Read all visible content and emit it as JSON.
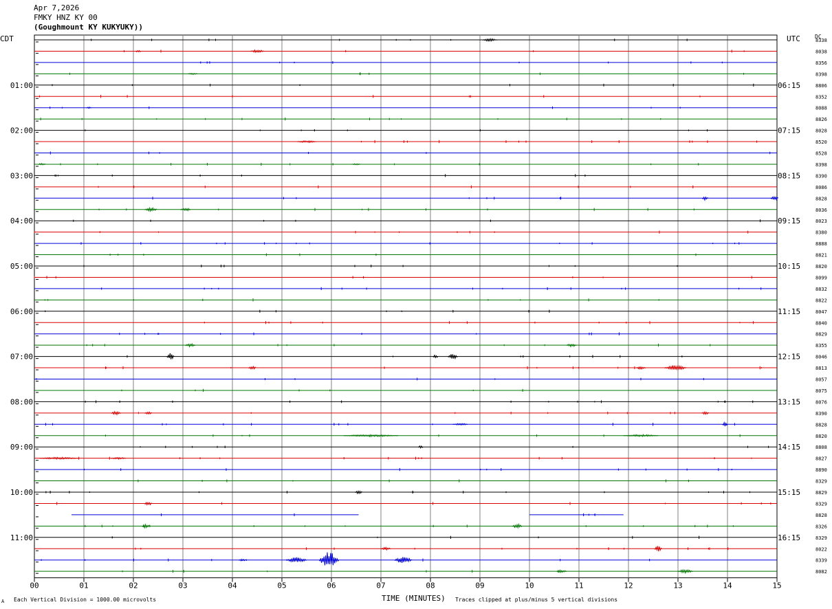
{
  "header": {
    "date": "Apr 7,2026",
    "station": "FMKY HNZ KY 00",
    "location": "(Goughmount KY KUKYUKY))"
  },
  "left_label": "CDT",
  "right_label": "UTC",
  "dc_label": "DC",
  "footer": {
    "scale": "Each Vertical Division = 1000.00 microvolts",
    "xlabel": "TIME (MINUTES)",
    "clip": "Traces clipped at plus/minus 5 vertical divisions",
    "corner_mark": "A"
  },
  "colors": {
    "black": "#000000",
    "red": "#dd0000",
    "blue": "#0000dd",
    "green": "#007700",
    "grid": "#808080"
  },
  "chart_data": {
    "type": "line",
    "title": "",
    "xlabel": "TIME (MINUTES)",
    "ylabel": "",
    "xlim": [
      0,
      15
    ],
    "x_ticks": [
      "00",
      "01",
      "02",
      "03",
      "04",
      "05",
      "06",
      "07",
      "08",
      "09",
      "10",
      "11",
      "12",
      "13",
      "14",
      "15"
    ],
    "trace_count": 48,
    "trace_color_cycle": [
      "black",
      "red",
      "blue",
      "green"
    ],
    "left_time_labels": [
      "01:00",
      "02:00",
      "03:00",
      "04:00",
      "05:00",
      "06:00",
      "07:00",
      "08:00",
      "09:00",
      "10:00",
      "11:00"
    ],
    "right_time_labels": [
      "06:15",
      "07:15",
      "08:15",
      "09:15",
      "10:15",
      "11:15",
      "12:15",
      "13:15",
      "14:15",
      "15:15",
      "16:15"
    ],
    "hour_label_trace_indices": [
      4,
      8,
      12,
      16,
      20,
      24,
      28,
      32,
      36,
      40,
      44
    ],
    "dc_values": [
      "8338",
      "8038",
      "8356",
      "8398",
      "8806",
      "8352",
      "8088",
      "8826",
      "8028",
      "8520",
      "8528",
      "8398",
      "8390",
      "8086",
      "8828",
      "8036",
      "8023",
      "8380",
      "8888",
      "8821",
      "8820",
      "8099",
      "8832",
      "8822",
      "8047",
      "8840",
      "8829",
      "8355",
      "8046",
      "8813",
      "8057",
      "8075",
      "8076",
      "8390",
      "8828",
      "8820",
      "8808",
      "8827",
      "8890",
      "8329",
      "8829",
      "8329",
      "8828",
      "8326",
      "8329",
      "8022",
      "8339",
      "8082"
    ],
    "events": [
      {
        "trace": 0,
        "minute": 9.2,
        "width": 0.3,
        "amp": 2
      },
      {
        "trace": 1,
        "minute": 2.1,
        "width": 0.1,
        "amp": 2
      },
      {
        "trace": 1,
        "minute": 4.5,
        "width": 0.3,
        "amp": 2
      },
      {
        "trace": 3,
        "minute": 3.2,
        "width": 0.2,
        "amp": 1
      },
      {
        "trace": 6,
        "minute": 1.1,
        "width": 0.1,
        "amp": 1
      },
      {
        "trace": 9,
        "minute": 5.5,
        "width": 0.4,
        "amp": 1.5
      },
      {
        "trace": 11,
        "minute": 0.15,
        "width": 0.15,
        "amp": 1.5
      },
      {
        "trace": 11,
        "minute": 6.5,
        "width": 0.2,
        "amp": 1
      },
      {
        "trace": 14,
        "minute": 13.55,
        "width": 0.12,
        "amp": 3
      },
      {
        "trace": 14,
        "minute": 14.95,
        "width": 0.15,
        "amp": 4
      },
      {
        "trace": 15,
        "minute": 2.35,
        "width": 0.25,
        "amp": 3
      },
      {
        "trace": 15,
        "minute": 3.05,
        "width": 0.2,
        "amp": 2.5
      },
      {
        "trace": 27,
        "minute": 3.15,
        "width": 0.2,
        "amp": 2.5
      },
      {
        "trace": 27,
        "minute": 10.85,
        "width": 0.2,
        "amp": 2.5
      },
      {
        "trace": 28,
        "minute": 2.75,
        "width": 0.15,
        "amp": 5
      },
      {
        "trace": 28,
        "minute": 8.1,
        "width": 0.1,
        "amp": 3
      },
      {
        "trace": 28,
        "minute": 8.45,
        "width": 0.2,
        "amp": 4
      },
      {
        "trace": 29,
        "minute": 4.4,
        "width": 0.15,
        "amp": 3
      },
      {
        "trace": 29,
        "minute": 12.25,
        "width": 0.2,
        "amp": 2
      },
      {
        "trace": 29,
        "minute": 12.95,
        "width": 0.45,
        "amp": 4
      },
      {
        "trace": 33,
        "minute": 1.65,
        "width": 0.2,
        "amp": 2.5
      },
      {
        "trace": 33,
        "minute": 2.3,
        "width": 0.15,
        "amp": 2
      },
      {
        "trace": 33,
        "minute": 13.55,
        "width": 0.15,
        "amp": 2
      },
      {
        "trace": 34,
        "minute": 8.6,
        "width": 0.3,
        "amp": 1.5
      },
      {
        "trace": 34,
        "minute": 13.95,
        "width": 0.1,
        "amp": 4
      },
      {
        "trace": 35,
        "minute": 6.8,
        "width": 1.1,
        "amp": 1.5
      },
      {
        "trace": 35,
        "minute": 12.25,
        "width": 0.7,
        "amp": 1.5
      },
      {
        "trace": 36,
        "minute": 7.8,
        "width": 0.1,
        "amp": 2
      },
      {
        "trace": 37,
        "minute": 0.5,
        "width": 0.8,
        "amp": 1.5
      },
      {
        "trace": 37,
        "minute": 1.7,
        "width": 0.3,
        "amp": 1.5
      },
      {
        "trace": 40,
        "minute": 6.55,
        "width": 0.15,
        "amp": 2.5
      },
      {
        "trace": 41,
        "minute": 2.3,
        "width": 0.15,
        "amp": 3
      },
      {
        "trace": 43,
        "minute": 2.25,
        "width": 0.15,
        "amp": 3
      },
      {
        "trace": 43,
        "minute": 9.75,
        "width": 0.2,
        "amp": 3
      },
      {
        "trace": 45,
        "minute": 7.1,
        "width": 0.2,
        "amp": 2
      },
      {
        "trace": 45,
        "minute": 12.6,
        "width": 0.15,
        "amp": 4
      },
      {
        "trace": 46,
        "minute": 4.2,
        "width": 0.15,
        "amp": 2
      },
      {
        "trace": 46,
        "minute": 5.3,
        "width": 0.4,
        "amp": 4
      },
      {
        "trace": 46,
        "minute": 5.95,
        "width": 0.4,
        "amp": 12
      },
      {
        "trace": 46,
        "minute": 7.45,
        "width": 0.35,
        "amp": 5
      },
      {
        "trace": 47,
        "minute": 10.65,
        "width": 0.2,
        "amp": 2
      },
      {
        "trace": 47,
        "minute": 13.15,
        "width": 0.3,
        "amp": 3
      }
    ],
    "gaps": [
      {
        "trace": 42,
        "from": 0.0,
        "to": 0.75
      },
      {
        "trace": 42,
        "from": 6.55,
        "to": 10.0
      },
      {
        "trace": 42,
        "from": 11.9,
        "to": 15.0
      }
    ]
  }
}
